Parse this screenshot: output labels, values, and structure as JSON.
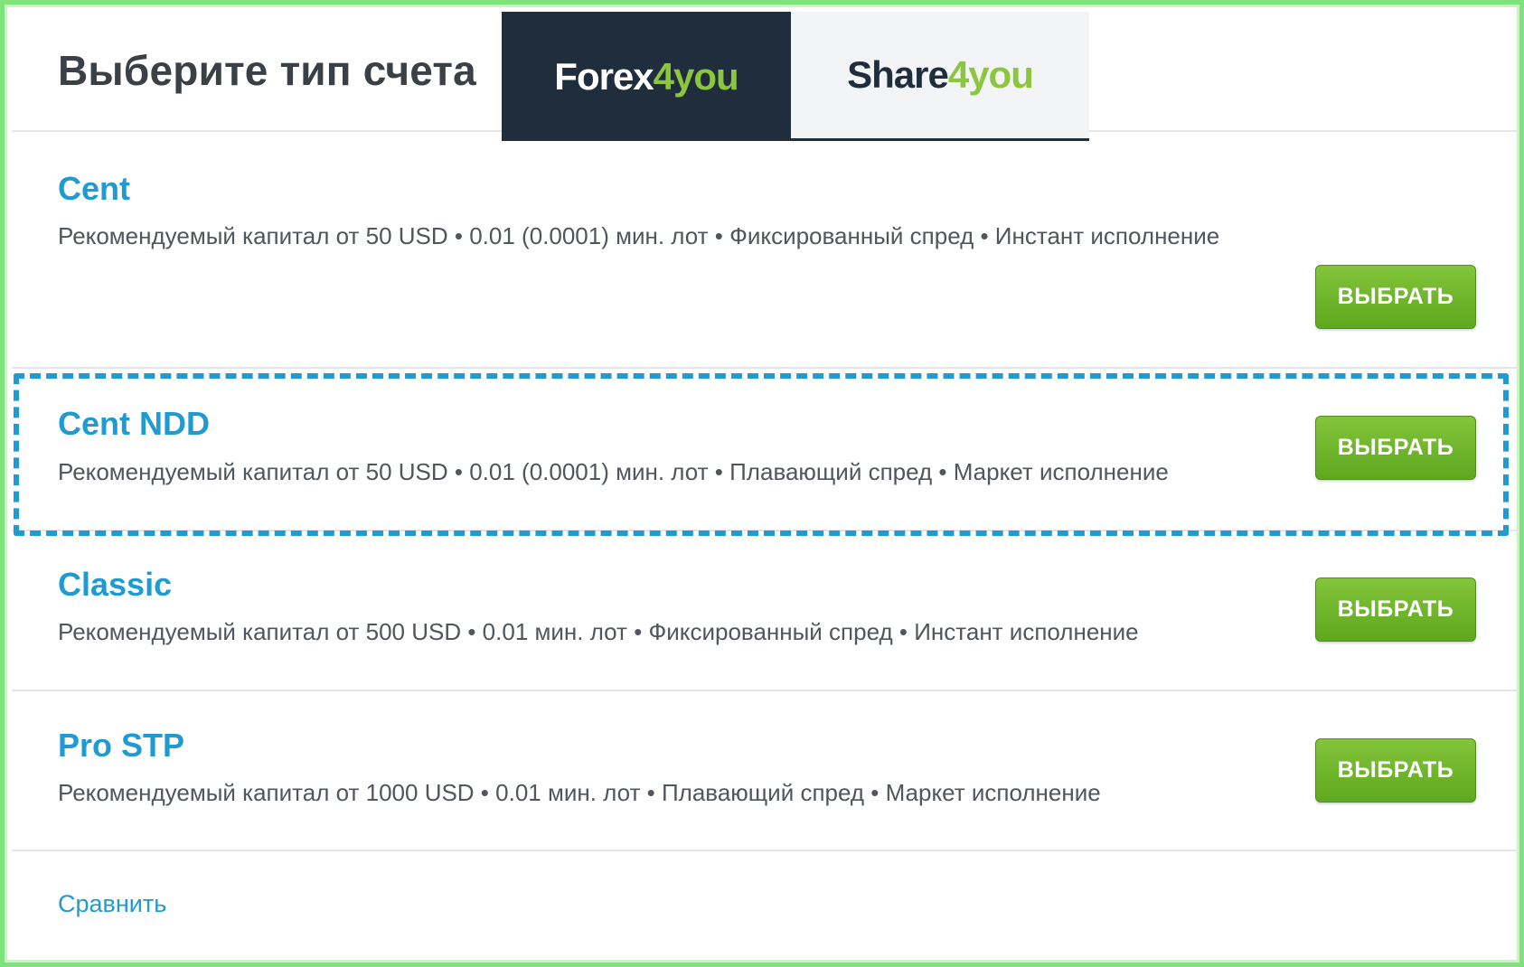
{
  "header": {
    "title": "Выберите тип счета",
    "tabs": [
      {
        "part1": "Forex",
        "part2": "4you"
      },
      {
        "part1": "Share",
        "part2": "4you"
      }
    ]
  },
  "accounts": [
    {
      "name": "Cent",
      "description": "Рекомендуемый капитал от 50 USD • 0.01 (0.0001) мин. лот • Фиксированный спред • Инстант исполнение",
      "button": "ВЫБРАТЬ"
    },
    {
      "name": "Cent NDD",
      "description": "Рекомендуемый капитал от 50 USD • 0.01 (0.0001) мин. лот • Плавающий спред • Маркет исполнение",
      "button": "ВЫБРАТЬ"
    },
    {
      "name": "Classic",
      "description": "Рекомендуемый капитал от 500 USD • 0.01 мин. лот • Фиксированный спред • Инстант исполнение",
      "button": "ВЫБРАТЬ"
    },
    {
      "name": "Pro STP",
      "description": "Рекомендуемый капитал от 1000 USD • 0.01 мин. лот • Плавающий спред • Маркет исполнение",
      "button": "ВЫБРАТЬ"
    }
  ],
  "footer": {
    "compare_label": "Сравнить"
  },
  "colors": {
    "accent": "#1f9bd1",
    "button_green": "#6cb52b",
    "tab_dark": "#1f2d3d",
    "logo_green": "#8cc63f",
    "frame_green": "#7fe27a"
  }
}
